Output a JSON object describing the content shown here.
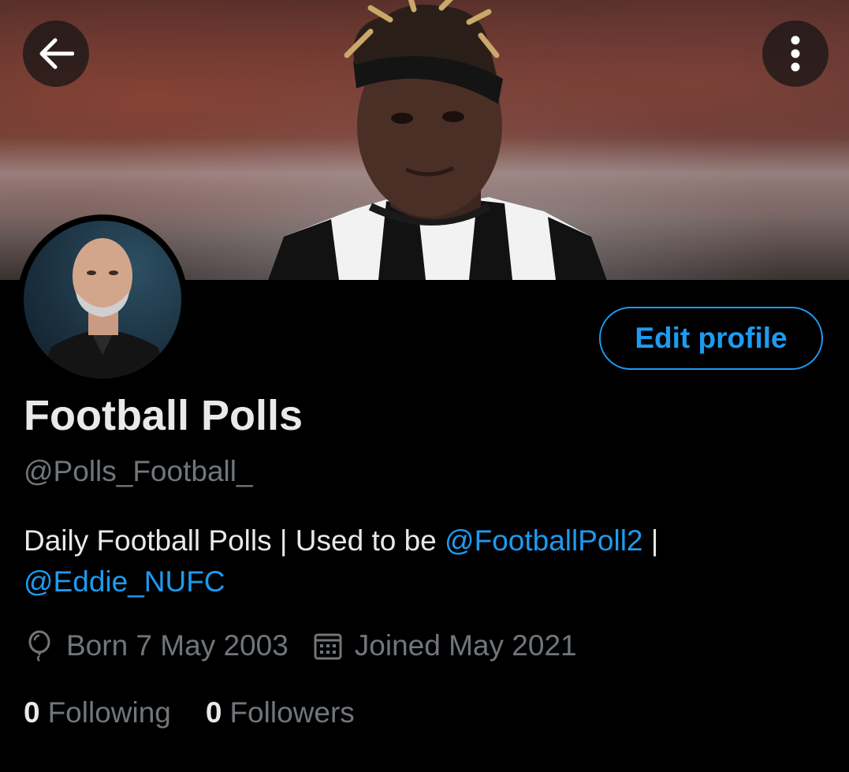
{
  "header": {
    "back_icon": "arrow-left-icon",
    "more_icon": "more-vertical-icon"
  },
  "profile": {
    "name": "Football Polls",
    "handle": "@Polls_Football_",
    "bio_text": "Daily Football Polls | Used to be ",
    "bio_mention_1": "@FootballPoll2",
    "bio_separator": " |",
    "bio_mention_2": "@Eddie_NUFC",
    "born": "Born 7 May 2003",
    "joined": "Joined May 2021",
    "following_count": "0",
    "following_label": "Following",
    "followers_count": "0",
    "followers_label": "Followers"
  },
  "actions": {
    "edit_profile_label": "Edit profile"
  },
  "colors": {
    "accent": "#1d9bf0",
    "background": "#000000",
    "primary_text": "#e7e9ea",
    "secondary_text": "#71767b"
  }
}
